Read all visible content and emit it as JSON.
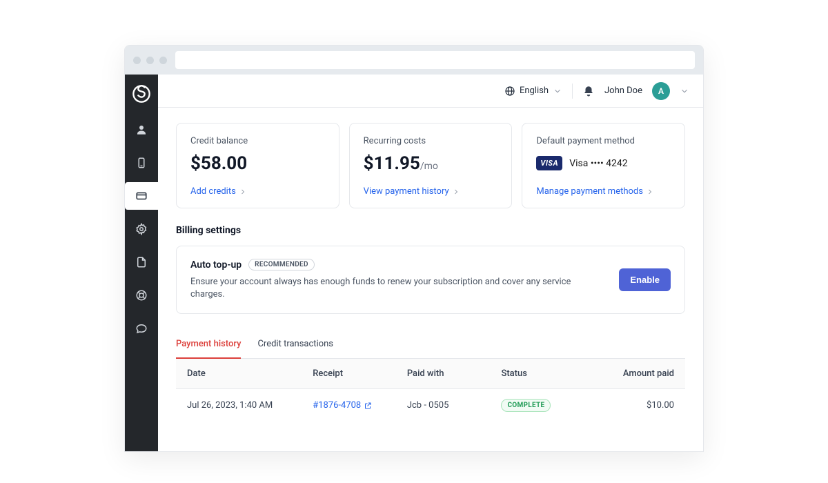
{
  "topbar": {
    "language": "English",
    "username": "John Doe",
    "avatar_initial": "A"
  },
  "cards": {
    "balance": {
      "label": "Credit balance",
      "value": "$58.00",
      "link": "Add credits"
    },
    "recurring": {
      "label": "Recurring costs",
      "value": "$11.95",
      "suffix": "/mo",
      "link": "View payment history"
    },
    "payment": {
      "label": "Default payment method",
      "brand": "VISA",
      "text": "Visa •••• 4242",
      "link": "Manage payment methods"
    }
  },
  "billing": {
    "section_title": "Billing settings",
    "auto_topup": {
      "title": "Auto top-up",
      "badge": "RECOMMENDED",
      "description": "Ensure your account always has enough funds to renew your subscription and cover any service charges.",
      "button": "Enable"
    }
  },
  "tabs": {
    "payment_history": "Payment history",
    "credit_transactions": "Credit transactions"
  },
  "table": {
    "headers": {
      "date": "Date",
      "receipt": "Receipt",
      "paid_with": "Paid with",
      "status": "Status",
      "amount": "Amount paid"
    },
    "rows": [
      {
        "date": "Jul 26, 2023, 1:40 AM",
        "receipt": "#1876-4708",
        "paid_with": "Jcb - 0505",
        "status": "COMPLETE",
        "amount": "$10.00"
      }
    ]
  }
}
